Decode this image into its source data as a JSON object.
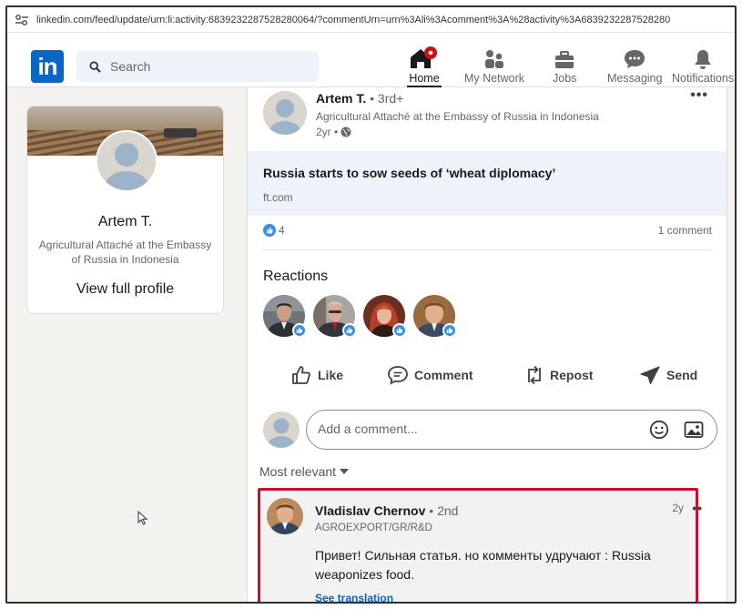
{
  "browser": {
    "url": "linkedin.com/feed/update/urn:li:activity:6839232287528280064/?commentUrn=urn%3Ali%3Acomment%3A%28activity%3A6839232287528280"
  },
  "nav": {
    "logo_text": "in",
    "search_placeholder": "Search",
    "items": [
      {
        "label": "Home",
        "icon": "home-icon",
        "active": true
      },
      {
        "label": "My Network",
        "icon": "people-icon"
      },
      {
        "label": "Jobs",
        "icon": "briefcase-icon"
      },
      {
        "label": "Messaging",
        "icon": "chat-icon"
      },
      {
        "label": "Notifications",
        "icon": "bell-icon"
      }
    ]
  },
  "profile_card": {
    "name": "Artem T.",
    "headline": "Agricultural Attaché at the Embassy of Russia in Indonesia",
    "link_label": "View full profile"
  },
  "post": {
    "author": "Artem T.",
    "degree": " • 3rd+",
    "headline": "Agricultural Attaché at the Embassy of Russia in Indonesia",
    "time": "2yr •",
    "menu": "•••",
    "link": {
      "title": "Russia starts to sow seeds of ‘wheat diplomacy’",
      "source": "ft.com"
    },
    "like_count": "4",
    "comment_count": "1 comment"
  },
  "reactions": {
    "title": "Reactions",
    "reactors": [
      {
        "name": "reactor-1"
      },
      {
        "name": "reactor-2"
      },
      {
        "name": "reactor-3"
      },
      {
        "name": "reactor-4"
      }
    ]
  },
  "actions": {
    "like": "Like",
    "comment": "Comment",
    "repost": "Repost",
    "send": "Send"
  },
  "comment_input": {
    "placeholder": "Add a comment..."
  },
  "sort": {
    "label": "Most relevant"
  },
  "comment": {
    "author": "Vladislav Chernov",
    "degree": " • 2nd",
    "headline": "AGROEXPORT/GR/R&D",
    "time": "2y",
    "menu": "••",
    "text": "Привет! Сильная статья. но комменты удручают : Russia weaponizes food.",
    "translate_label": "See translation"
  },
  "colors": {
    "brand_blue": "#0a66c2",
    "reaction_blue": "#378fe9",
    "highlight_red": "#c8102e",
    "notification_red": "#cc1016"
  }
}
